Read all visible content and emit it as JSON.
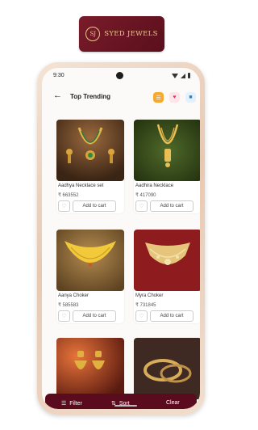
{
  "logo": {
    "monogram": "SJ",
    "name": "SYED JEWELS"
  },
  "status_bar": {
    "time": "9:30"
  },
  "header": {
    "title": "Top Trending"
  },
  "icons": {
    "back": "arrow-left-icon",
    "list": "list-icon",
    "wishlist": "heart-icon",
    "cart": "cart-icon"
  },
  "products": [
    {
      "name": "Aadhya Necklace set",
      "price": "₹ 663552",
      "add_label": "Add to cart"
    },
    {
      "name": "Aadhira Necklace",
      "price": "₹ 417090",
      "add_label": "Add to cart"
    },
    {
      "name": "Aanya Choker",
      "price": "₹ 585583",
      "add_label": "Add to cart"
    },
    {
      "name": "Myra Choker",
      "price": "₹ 731845",
      "add_label": "Add to cart"
    },
    {
      "name": "",
      "price": "",
      "add_label": ""
    },
    {
      "name": "",
      "price": "",
      "add_label": ""
    }
  ],
  "bottom_bar": {
    "filter_label": "Filter",
    "sort_label": "Sort",
    "clear_label": "Clear"
  },
  "colors": {
    "brand": "#5b0b1e",
    "gold": "#e8c98a",
    "accent_orange": "#f6a92d"
  }
}
